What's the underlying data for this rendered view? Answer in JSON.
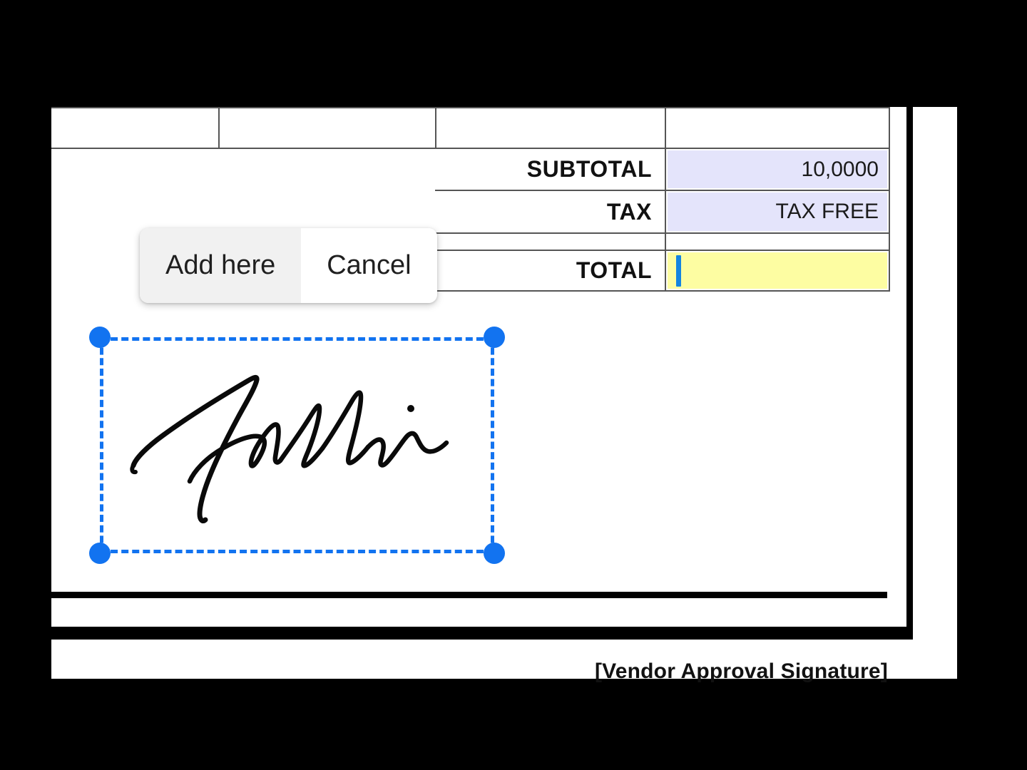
{
  "document": {
    "type": "invoice-totals-section",
    "rows": [
      {
        "label": "SUBTOTAL",
        "value": "10,0000",
        "fill": "lavender"
      },
      {
        "label": "TAX",
        "value": "TAX FREE",
        "fill": "lavender"
      },
      {
        "label": "TOTAL",
        "value": "",
        "fill": "yellow"
      }
    ],
    "vendor_signature_label": "[Vendor Approval Signature]"
  },
  "popup": {
    "add_label": "Add here",
    "cancel_label": "Cancel"
  },
  "selection": {
    "handle_count": 4,
    "accent_color": "#1273f0",
    "content": "handwritten-signature"
  },
  "colors": {
    "accent_blue": "#1273f0",
    "caret_blue": "#1484e0",
    "lavender_fill": "#e4e4fb",
    "yellow_fill": "#fdfda2",
    "rule_grey": "#555555",
    "ink_black": "#000000",
    "backdrop": "#000000"
  }
}
